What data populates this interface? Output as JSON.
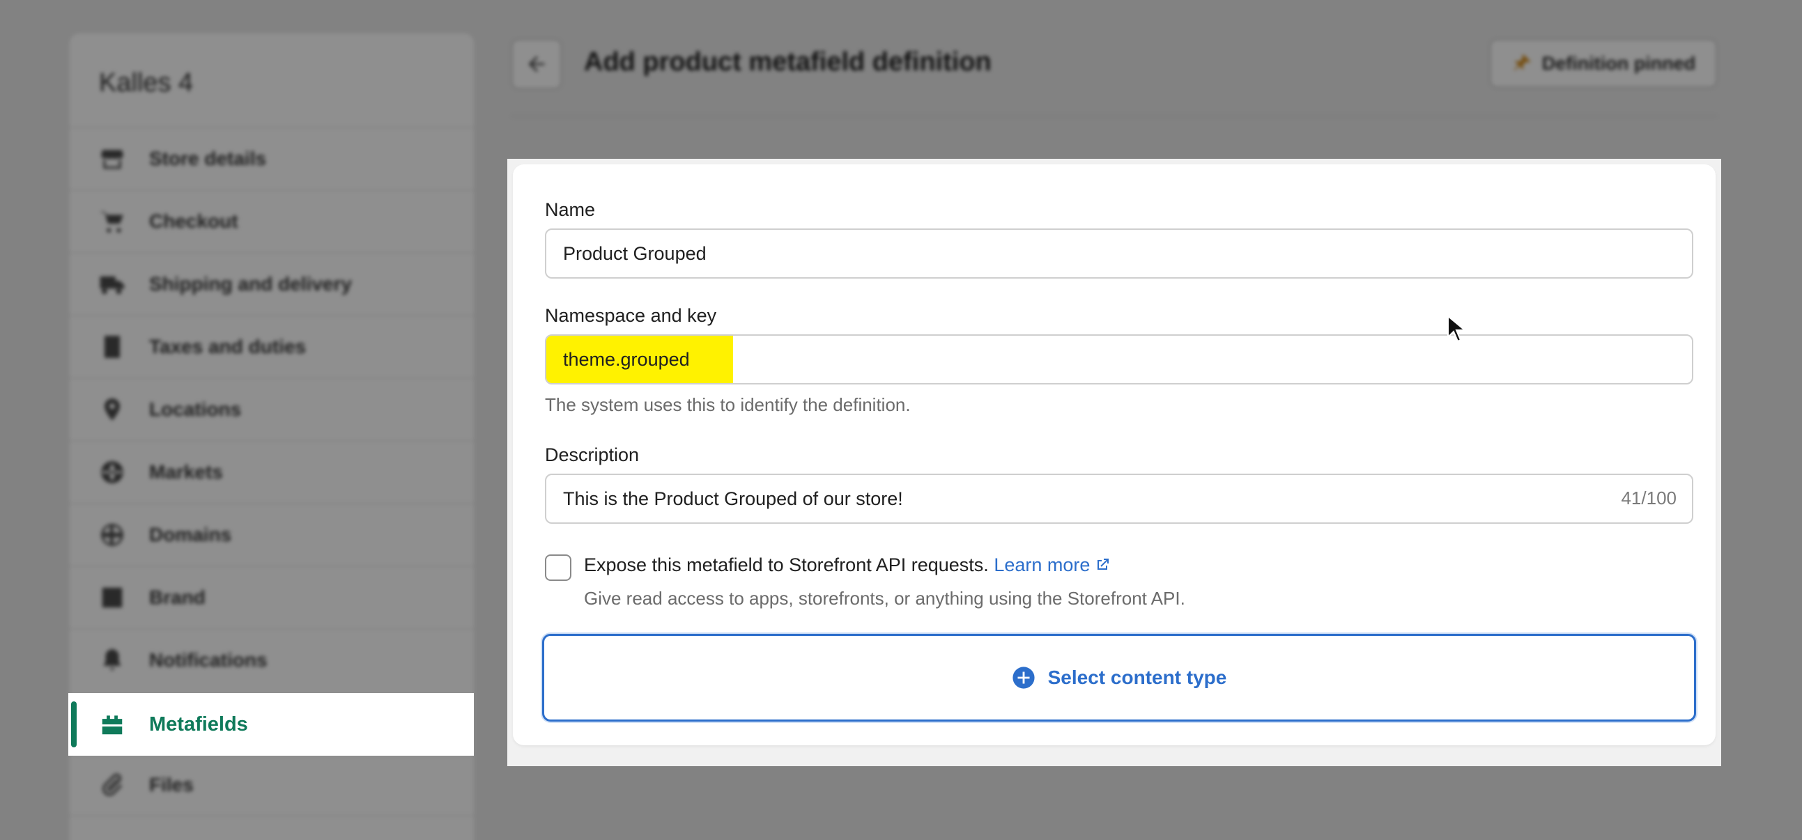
{
  "sidebar": {
    "store_name": "Kalles 4",
    "items": [
      {
        "label": "Store details",
        "icon": "store-icon"
      },
      {
        "label": "Checkout",
        "icon": "cart-icon"
      },
      {
        "label": "Shipping and delivery",
        "icon": "truck-icon"
      },
      {
        "label": "Taxes and duties",
        "icon": "receipt-icon"
      },
      {
        "label": "Locations",
        "icon": "location-pin-icon"
      },
      {
        "label": "Markets",
        "icon": "globe-icon"
      },
      {
        "label": "Domains",
        "icon": "globe-icon"
      },
      {
        "label": "Brand",
        "icon": "brand-icon"
      },
      {
        "label": "Notifications",
        "icon": "bell-icon"
      },
      {
        "label": "Metafields",
        "icon": "metafields-icon"
      },
      {
        "label": "Files",
        "icon": "paperclip-icon"
      }
    ],
    "active_label": "Metafields"
  },
  "header": {
    "title": "Add product metafield definition",
    "pin_label": "Definition pinned"
  },
  "form": {
    "name_label": "Name",
    "name_value": "Product Grouped",
    "namespace_label": "Namespace and key",
    "namespace_value": "theme.grouped",
    "namespace_help": "The system uses this to identify the definition.",
    "description_label": "Description",
    "description_value": "This is the Product Grouped of our store!",
    "description_counter": "41/100",
    "expose_label": "Expose this metafield to Storefront API requests.",
    "learn_more": "Learn more",
    "expose_help": "Give read access to apps, storefronts, or anything using the Storefront API.",
    "select_content_type": "Select content type"
  },
  "colors": {
    "accent": "#2c6ecb",
    "active_nav": "#0f7a5a",
    "highlight": "#fff200"
  }
}
